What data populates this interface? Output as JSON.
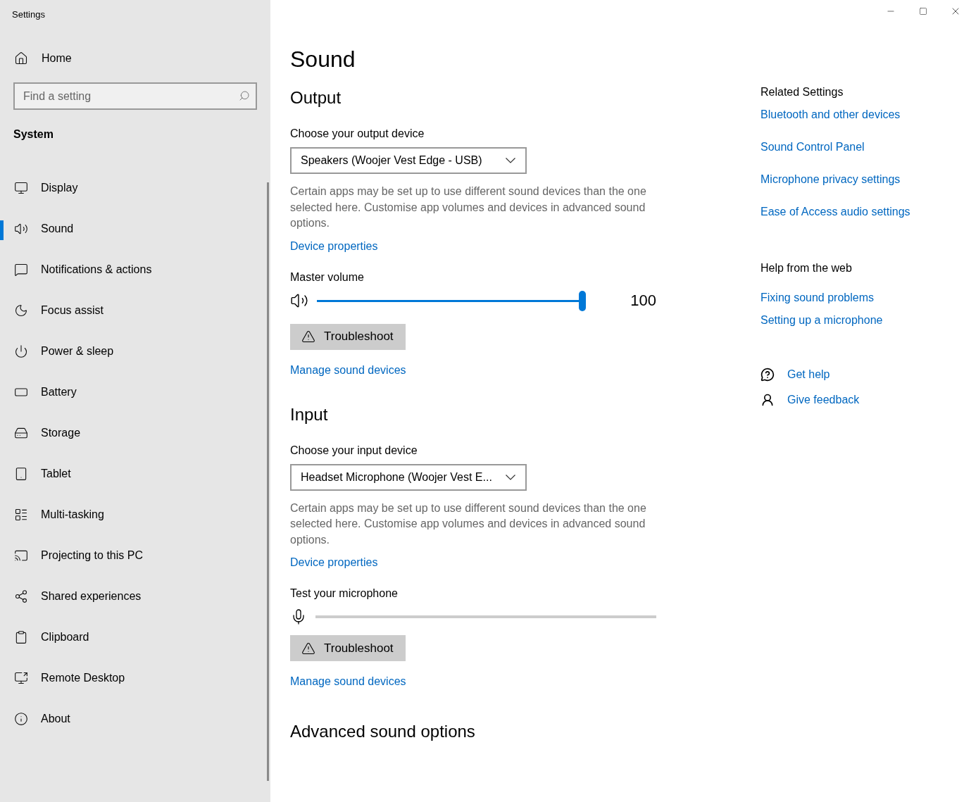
{
  "window": {
    "title": "Settings"
  },
  "sidebar": {
    "home": "Home",
    "search": {
      "placeholder": "Find a setting"
    },
    "section": "System",
    "items": [
      {
        "label": "Display",
        "selected": false
      },
      {
        "label": "Sound",
        "selected": true
      },
      {
        "label": "Notifications & actions",
        "selected": false
      },
      {
        "label": "Focus assist",
        "selected": false
      },
      {
        "label": "Power & sleep",
        "selected": false
      },
      {
        "label": "Battery",
        "selected": false
      },
      {
        "label": "Storage",
        "selected": false
      },
      {
        "label": "Tablet",
        "selected": false
      },
      {
        "label": "Multi-tasking",
        "selected": false
      },
      {
        "label": "Projecting to this PC",
        "selected": false
      },
      {
        "label": "Shared experiences",
        "selected": false
      },
      {
        "label": "Clipboard",
        "selected": false
      },
      {
        "label": "Remote Desktop",
        "selected": false
      },
      {
        "label": "About",
        "selected": false
      }
    ]
  },
  "page": {
    "title": "Sound",
    "output": {
      "heading": "Output",
      "device_label": "Choose your output device",
      "device_value": "Speakers (Woojer Vest Edge - USB)",
      "note": "Certain apps may be set up to use different sound devices than the one selected here. Customise app volumes and devices in advanced sound options.",
      "device_properties": "Device properties",
      "volume_label": "Master volume",
      "volume": {
        "level": 1,
        "reading": "100"
      },
      "troubleshoot": "Troubleshoot",
      "manage": "Manage sound devices"
    },
    "input": {
      "heading": "Input",
      "device_label": "Choose your input device",
      "device_value": "Headset Microphone (Woojer Vest E...",
      "note": "Certain apps may be set up to use different sound devices than the one selected here. Customise app volumes and devices in advanced sound options.",
      "device_properties": "Device properties",
      "test_label": "Test your microphone",
      "mic_meter": {
        "level": 0
      },
      "troubleshoot": "Troubleshoot",
      "manage": "Manage sound devices"
    },
    "advanced_heading": "Advanced sound options"
  },
  "related": {
    "heading": "Related Settings",
    "links": [
      "Bluetooth and other devices",
      "Sound Control Panel",
      "Microphone privacy settings",
      "Ease of Access audio settings"
    ]
  },
  "help": {
    "heading": "Help from the web",
    "links": [
      "Fixing sound problems",
      "Setting up a microphone"
    ]
  },
  "actions": [
    {
      "kind": "help",
      "label": "Get help"
    },
    {
      "kind": "feedback",
      "label": "Give feedback"
    }
  ]
}
